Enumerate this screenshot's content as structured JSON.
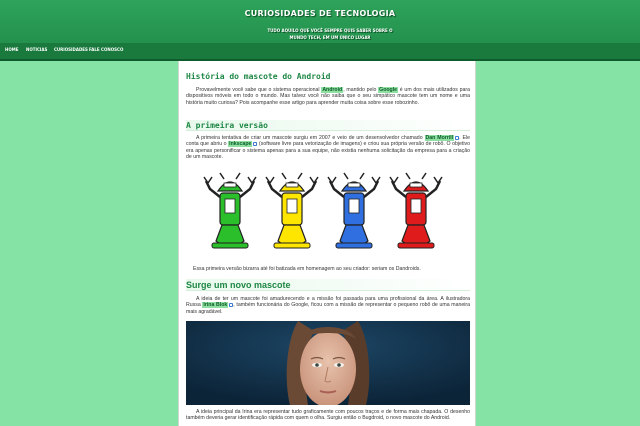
{
  "site": {
    "title": "CURIOSIDADES DE TECNOLOGIA",
    "tagline": "TUDO AQUILO QUE VOCÊ SEMPRE QUIS SABER SOBRE O MUNDO TECH, EM UM ÚNICO LUGAR"
  },
  "nav": [
    {
      "label": "HOME"
    },
    {
      "label": "NOTICIAS"
    },
    {
      "label": "CURIOSIDADES"
    },
    {
      "label": "FALE CONOSCO"
    }
  ],
  "article": {
    "title": "História do mascote do Android",
    "intro": {
      "t1": "Provavelmente você sabe que o sistema operacional ",
      "link_android": "Android",
      "t2": ", mantido pelo ",
      "link_google": "Google",
      "t3": " é um dos mais utilizados para dispositivos móveis em todo o mundo. Mas talvez você não saiba que o seu simpático mascote tem um nome e uma história muito curiosa? Pois acompanhe esse artigo para aprender muita coisa sobre esse robozinho."
    },
    "section1": {
      "heading": "A primeira versão",
      "p": {
        "t1": "A primeira tentativa de criar um mascote surgiu em 2007 e veio de um desenvolvedor chamado ",
        "link_dan": "Dan Morrill",
        "t2": ". Ele conta que abriu o ",
        "link_inkscape": "Inkscape",
        "t3": " (software livre para vetorização de imagens) e criou sua própria versão de robô. O objetivo era apenas personificar o sistema apenas para a sua equipe, não existia nenhuma solicitação da empresa para a criação de um mascote."
      },
      "robot_colors": [
        "#2bbf2b",
        "#ffe600",
        "#2f6fe0",
        "#e01b1b"
      ],
      "caption": "Essa primeira versão bizarra até foi batizada em homenagem ao seu criador: seriam os Dandroids."
    },
    "section2": {
      "heading": "Surge um novo mascote",
      "p": {
        "t1": "A ideia de ter um mascote foi amadurecendo e a missão foi passada para uma profissional da área. A ilustradora Russa ",
        "link_irina": "Irina Blok",
        "t2": ", também funcionária do Google, ficou com a missão de representar o pequeno robô de uma maneira mais agradável."
      },
      "p2": "A ideia principal da Irina era representar tudo graficamente com poucos traços e de forma mais chapada. O desenho também deveria gerar identificação rápida com quem o olha. Surgiu então o Bugdroid, o novo mascote do Android."
    }
  }
}
